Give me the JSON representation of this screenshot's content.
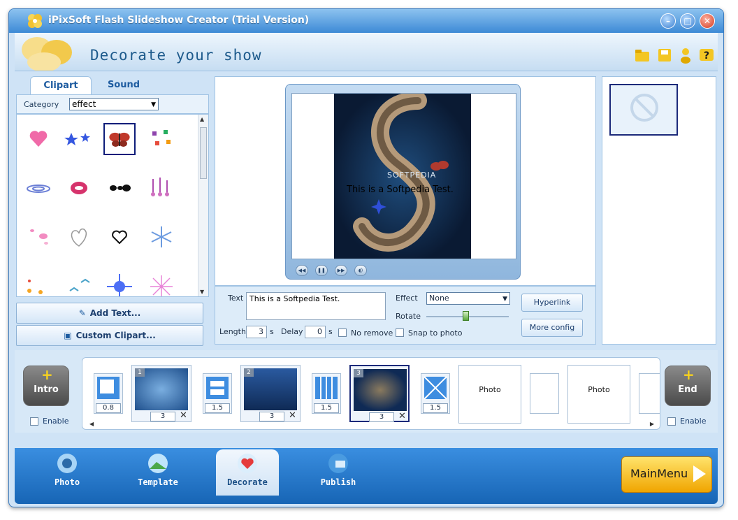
{
  "window": {
    "title": "iPixSoft Flash Slideshow Creator (Trial Version)"
  },
  "header": {
    "heading": "Decorate your show"
  },
  "left_panel": {
    "tabs": [
      "Clipart",
      "Sound"
    ],
    "category_label": "Category",
    "category_value": "effect",
    "add_text_label": "Add Text...",
    "custom_clipart_label": "Custom Clipart..."
  },
  "preview": {
    "overlay_text": "This is a Softpedia Test.",
    "watermark": "SOFTPEDIA"
  },
  "props": {
    "text_label": "Text",
    "text_value": "This is a Softpedia Test.",
    "effect_label": "Effect",
    "effect_value": "None",
    "rotate_label": "Rotate",
    "length_label": "Length",
    "length_value": "3",
    "length_unit": "s",
    "delay_label": "Delay",
    "delay_value": "0",
    "delay_unit": "s",
    "no_remove_label": "No remove",
    "snap_label": "Snap to photo",
    "hyperlink_label": "Hyperlink",
    "more_config_label": "More config"
  },
  "timeline": {
    "intro_label": "Intro",
    "end_label": "End",
    "enable_label": "Enable",
    "slides": [
      {
        "num": "1",
        "duration": "3"
      },
      {
        "num": "2",
        "duration": "3"
      },
      {
        "num": "3",
        "duration": "3"
      }
    ],
    "transitions": [
      "0.8",
      "1.5",
      "1.5",
      "1.5"
    ],
    "placeholder_label": "Photo"
  },
  "nav": {
    "items": [
      "Photo",
      "Template",
      "Decorate",
      "Publish"
    ],
    "main_menu_label": "MainMenu"
  }
}
